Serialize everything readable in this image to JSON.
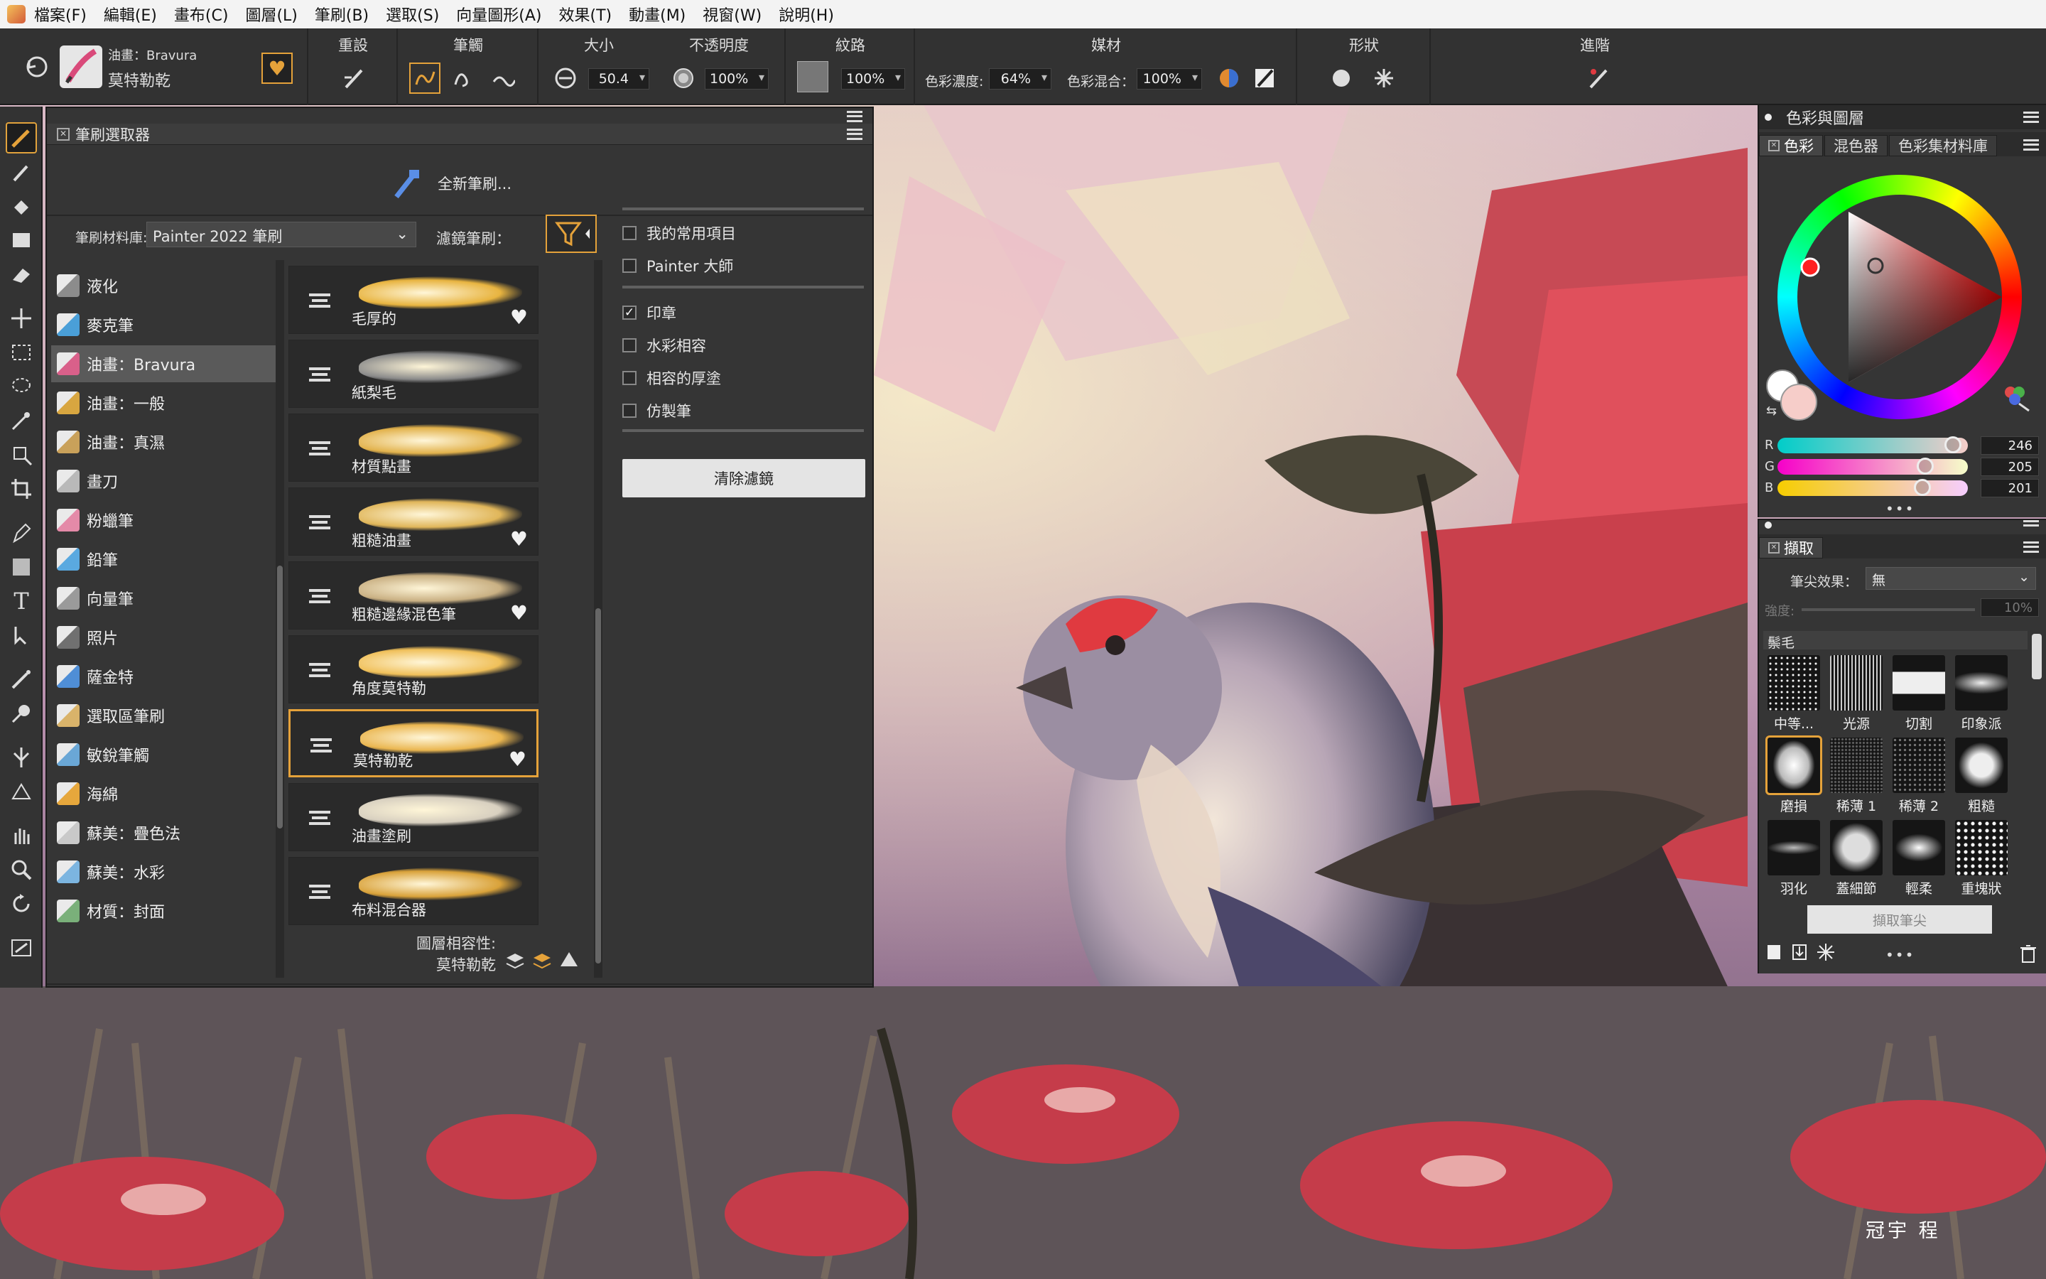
{
  "menu": [
    "檔案(F)",
    "編輯(E)",
    "畫布(C)",
    "圖層(L)",
    "筆刷(B)",
    "選取(S)",
    "向量圖形(A)",
    "效果(T)",
    "動畫(M)",
    "視窗(W)",
    "說明(H)"
  ],
  "propbar": {
    "current_category": "油畫：Bravura",
    "current_variant": "莫特勒乾",
    "reset": "重設",
    "dab": "筆觸",
    "size": "大小",
    "size_value": "50.4",
    "opacity": "不透明度",
    "opacity_value": "100%",
    "grain": "紋路",
    "grain_value": "100%",
    "media": "媒材",
    "resat_label": "色彩濃度:",
    "resat_value": "64%",
    "bleed_label": "色彩混合：",
    "bleed_value": "100%",
    "shape": "形狀",
    "advanced": "進階"
  },
  "brush_selector": {
    "title": "筆刷選取器",
    "new_brush": "全新筆刷...",
    "library_label": "筆刷材料庫:",
    "library_value": "Painter 2022 筆刷",
    "filter_label": "濾鏡筆刷：",
    "categories": [
      {
        "label": "液化",
        "color": "#8c8c8c"
      },
      {
        "label": "麥克筆",
        "color": "#4a9fd8"
      },
      {
        "label": "油畫：Bravura",
        "color": "#d9608a"
      },
      {
        "label": "油畫：一般",
        "color": "#d8a640"
      },
      {
        "label": "油畫：真濕",
        "color": "#c9a15a"
      },
      {
        "label": "畫刀",
        "color": "#b9b9b9"
      },
      {
        "label": "粉蠟筆",
        "color": "#e48aa8"
      },
      {
        "label": "鉛筆",
        "color": "#5aa9e0"
      },
      {
        "label": "向量筆",
        "color": "#9a9a9a"
      },
      {
        "label": "照片",
        "color": "#707070"
      },
      {
        "label": "薩金特",
        "color": "#4f8ed6"
      },
      {
        "label": "選取區筆刷",
        "color": "#d9b36a"
      },
      {
        "label": "敏銳筆觸",
        "color": "#6aa7d6"
      },
      {
        "label": "海綿",
        "color": "#e6a73c"
      },
      {
        "label": "蘇美：疊色法",
        "color": "#c9c9c9"
      },
      {
        "label": "蘇美：水彩",
        "color": "#7cb5e0"
      },
      {
        "label": "材質：封面",
        "color": "#7ab07a"
      }
    ],
    "variants": [
      {
        "label": "毛厚的",
        "fav": true,
        "color": "#e8b440"
      },
      {
        "label": "紙梨毛",
        "fav": false,
        "color": "#8a8a8a"
      },
      {
        "label": "材質點畫",
        "fav": false,
        "color": "#e2b24c"
      },
      {
        "label": "粗糙油畫",
        "fav": true,
        "color": "#e0b65a"
      },
      {
        "label": "粗糙邊緣混色筆",
        "fav": true,
        "color": "#c9b083"
      },
      {
        "label": "角度莫特勒",
        "fav": false,
        "color": "#f0c05a"
      },
      {
        "label": "莫特勒乾",
        "fav": true,
        "color": "#eab650"
      },
      {
        "label": "油畫塗刷",
        "fav": false,
        "color": "#d8d0c0"
      },
      {
        "label": "布料混合器",
        "fav": false,
        "color": "#d9a23a"
      }
    ],
    "filters": [
      {
        "label": "我的常用項目",
        "checked": false
      },
      {
        "label": "Painter 大師",
        "checked": false
      },
      {
        "label": "印章",
        "checked": true
      },
      {
        "label": "水彩相容",
        "checked": false
      },
      {
        "label": "相容的厚塗",
        "checked": false
      },
      {
        "label": "仿製筆",
        "checked": false
      }
    ],
    "clear_filter": "清除濾鏡",
    "compat_label": "圖層相容性:",
    "compat_variant": "莫特勒乾"
  },
  "color_panel": {
    "title": "色彩與圖層",
    "tabs": [
      "色彩",
      "混色器",
      "色彩集材料庫"
    ],
    "r": "246",
    "g": "205",
    "b": "201",
    "r_level": 0.965,
    "g_level": 0.804,
    "b_level": 0.788
  },
  "dab_panel": {
    "title": "擷取",
    "tip_label": "筆尖效果：",
    "tip_value": "無",
    "strength_label": "強度:",
    "strength_value": "10%",
    "section": "鬃毛",
    "dabs": [
      "中等...",
      "光源",
      "切割",
      "印象派",
      "磨損",
      "稀薄 1",
      "稀薄 2",
      "粗糙",
      "羽化",
      "蓋細節",
      "輕柔",
      "重塊狀"
    ],
    "capture_button": "擷取筆尖"
  },
  "signature": "冠宇 程"
}
